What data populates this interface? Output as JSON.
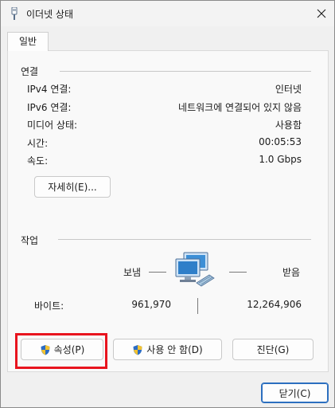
{
  "window": {
    "title": "이더넷 상태",
    "close_label": "✕"
  },
  "tabs": [
    {
      "label": "일반",
      "selected": true
    }
  ],
  "connection": {
    "section_title": "연결",
    "rows": [
      {
        "label": "IPv4 연결:",
        "value": "인터넷"
      },
      {
        "label": "IPv6 연결:",
        "value": "네트워크에 연결되어 있지 않음"
      },
      {
        "label": "미디어 상태:",
        "value": "사용함"
      },
      {
        "label": "시간:",
        "value": "00:05:53"
      },
      {
        "label": "속도:",
        "value": "1.0 Gbps"
      }
    ],
    "details_button": "자세히(E)..."
  },
  "activity": {
    "section_title": "작업",
    "sent_label": "보냄",
    "received_label": "받음",
    "bytes_label": "바이트:",
    "bytes_sent": "961,970",
    "bytes_received": "12,264,906"
  },
  "buttons": {
    "properties": "속성(P)",
    "disable": "사용 안 함(D)",
    "diagnose": "진단(G)",
    "close": "닫기(C)"
  },
  "colors": {
    "highlight": "#e8141e",
    "default_button_border": "#2c6fbf"
  }
}
